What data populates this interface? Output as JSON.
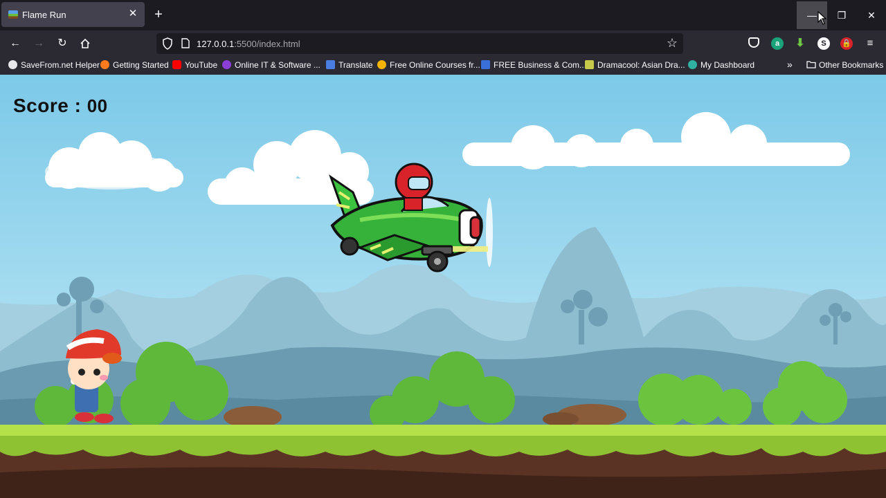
{
  "browser": {
    "tab_title": "Flame Run",
    "new_tab_icon": "+",
    "url_main": "127.0.0.1",
    "url_rest": ":5500/index.html",
    "bookmarks": [
      {
        "label": "SaveFrom.net Helper",
        "color": "#e8e8ea"
      },
      {
        "label": "Getting Started",
        "color": "#ff7b1c"
      },
      {
        "label": "YouTube",
        "color": "#ff0000"
      },
      {
        "label": "Online IT & Software ...",
        "color": "#8b3ed8"
      },
      {
        "label": "Translate",
        "color": "#4a7ee0"
      },
      {
        "label": "Free Online Courses fr...",
        "color": "#f4b400"
      },
      {
        "label": "FREE Business & Com...",
        "color": "#3a6fd8"
      },
      {
        "label": "Dramacool: Asian Dra...",
        "color": "#c6c94a"
      },
      {
        "label": "My Dashboard",
        "color": "#2fb0a0"
      }
    ],
    "other_bookmarks": "Other Bookmarks"
  },
  "game": {
    "score_label": "Score : ",
    "score_value": "00",
    "sky_color": "#84d0ec",
    "ground_color": "#a6d63c"
  }
}
